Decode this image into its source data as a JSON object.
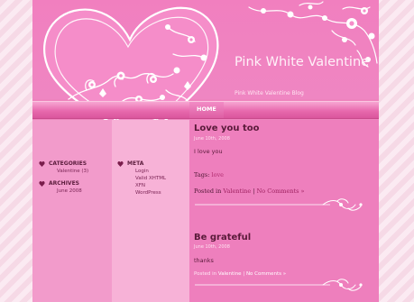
{
  "blog": {
    "title": "Pink White Valentine",
    "tagline": "Pink White Valentine Blog"
  },
  "nav": {
    "home": "HOME"
  },
  "sidebar": {
    "categories_title": "CATEGORIES",
    "categories_item": "Valentine (3)",
    "archives_title": "ARCHIVES",
    "archives_item": "June 2008",
    "meta_title": "META",
    "meta_items": [
      "Login",
      "Valid XHTML",
      "XFN",
      "WordPress"
    ]
  },
  "posts": [
    {
      "title": "Love you too",
      "date": "June 10th, 2008",
      "body": "I love you",
      "tags_label": "Tags:",
      "tag": "love",
      "posted_in": "Posted in",
      "category": "Valentine",
      "separator": "|",
      "comments": "No Comments »"
    },
    {
      "title": "Be grateful",
      "date": "June 10th, 2008",
      "body": "thanks",
      "posted_in": "Posted in",
      "category": "Valentine",
      "separator": "|",
      "comments": "No Comments »"
    }
  ],
  "colors": {
    "page": "#ee83bd",
    "accent": "#5a1a3a",
    "heart": "#7a1d4c"
  },
  "icons": [
    "heart-icon",
    "swirl-divider-icon"
  ]
}
